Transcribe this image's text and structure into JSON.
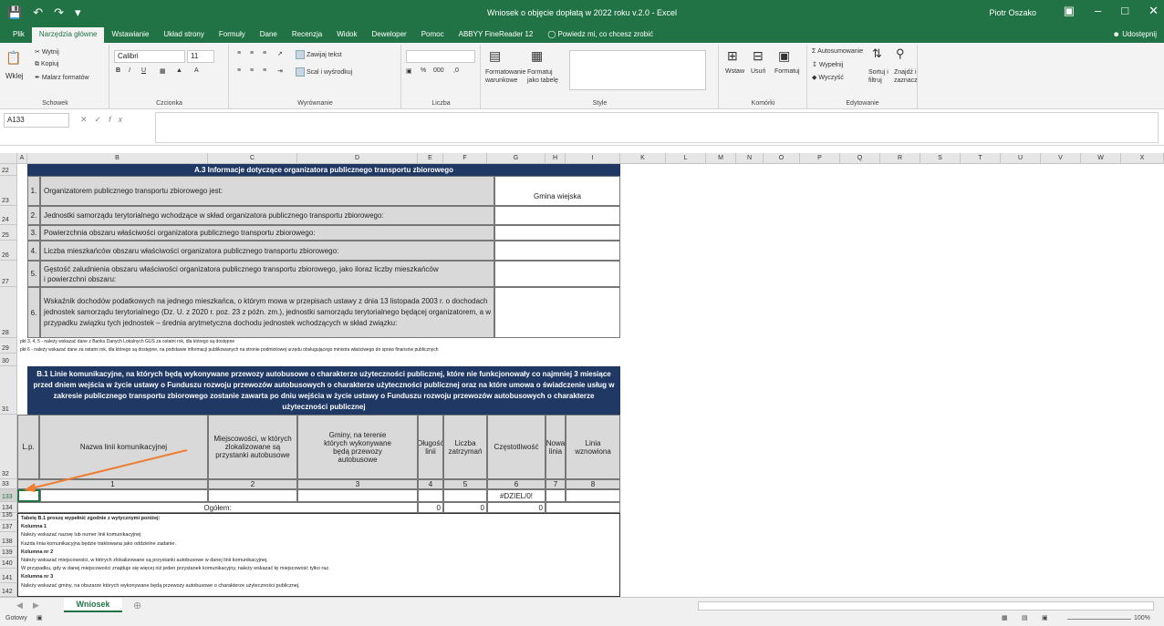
{
  "window": {
    "title": "Wniosek o objęcie dopłatą w 2022 roku v.2.0  -  Excel",
    "user": "Piotr Oszako"
  },
  "tabs": [
    "Plik",
    "Narzędzia główne",
    "Wstawianie",
    "Układ strony",
    "Formuły",
    "Dane",
    "Recenzja",
    "Widok",
    "Deweloper",
    "Pomoc",
    "ABBYY FineReader 12",
    "Powiedz mi, co chcesz zrobić"
  ],
  "share": "Udostępnij",
  "ribbon": {
    "clipboard": {
      "paste": "Wklej",
      "cut": "Wytnij",
      "copy": "Kopiuj",
      "painter": "Malarz formatów",
      "label": "Schowek"
    },
    "font": {
      "name": "Calibri",
      "size": "11",
      "label": "Czcionka"
    },
    "alignment": {
      "wrap": "Zawijaj tekst",
      "merge": "Scal i wyśrodkuj",
      "label": "Wyrównanie"
    },
    "number": {
      "label": "Liczba"
    },
    "styles": {
      "cond": "Formatowanie warunkowe",
      "table": "Formatuj jako tabelę",
      "label": "Style"
    },
    "cells": {
      "insert": "Wstaw",
      "delete": "Usuń",
      "format": "Formatuj",
      "label": "Komórki"
    },
    "editing": {
      "autosum": "Autosumowanie",
      "fill": "Wypełnij",
      "clear": "Wyczyść",
      "sort": "Sortuj i filtruj",
      "find": "Znajdź i zaznacz",
      "label": "Edytowanie"
    }
  },
  "formula": {
    "namebox": "A133",
    "fx": "fx"
  },
  "columns": [
    "A",
    "B",
    "C",
    "D",
    "E",
    "F",
    "G",
    "H",
    "I",
    "K",
    "L",
    "M",
    "N",
    "O",
    "P",
    "Q",
    "R",
    "S",
    "T",
    "U",
    "V",
    "W",
    "X"
  ],
  "rows": [
    "22",
    "23",
    "24",
    "25",
    "26",
    "27",
    "28",
    "29",
    "30",
    "31",
    "32",
    "33",
    "133",
    "134",
    "135",
    "137",
    "138",
    "139",
    "140",
    "141",
    "142"
  ],
  "sheet": {
    "a3_header": "A.3  Informacje dotyczące organizatora publicznego transportu zbiorowego",
    "items": [
      {
        "num": "1.",
        "text": "Organizatorem publicznego transportu zbiorowego jest:",
        "value": "Gmina wiejska"
      },
      {
        "num": "2.",
        "text": "Jednostki samorządu terytorialnego wchodzące w skład organizatora publicznego transportu zbiorowego:",
        "value": ""
      },
      {
        "num": "3.",
        "text": "Powierzchnia obszaru właściwości organizatora publicznego transportu zbiorowego:",
        "value": ""
      },
      {
        "num": "4.",
        "text": "Liczba mieszkańców obszaru właściwości organizatora publicznego transportu zbiorowego:",
        "value": ""
      },
      {
        "num": "5.",
        "text": "Gęstość zaludnienia obszaru właściwości organizatora publicznego transportu zbiorowego, jako iloraz liczby mieszkańców i powierzchni obszaru:",
        "value": ""
      },
      {
        "num": "6.",
        "text": "Wskaźnik dochodów podatkowych na jednego mieszkańca,  o którym mowa w przepisach ustawy z dnia 13 listopada 2003 r. o dochodach jednostek samorządu terytorialnego (Dz. U. z 2020 r. poz. 23  z późn. zm.), jednostki samorządu terytorialnego będącej organizatorem, a w przypadku związku tych jednostek – średnia arytmetyczna dochodu jednostek wchodzących w skład związku:",
        "value": ""
      }
    ],
    "note1": "pkt 3, 4, 5 - należy wskazać dane z Banku Danych Lokalnych GUS za ostatni rok, dla którego są dostępne",
    "note2": "pkt 6 - należy wskazać dane za ostatni rok, dla którego są dostępne, na podstawie informacji publikowanych  na stronie  podmiotowej urzędu obsługującego ministra właściwego do spraw finansów publicznych",
    "b1_header": "B.1 Linie komunikacyjne, na których będą wykonywane przewozy autobusowe o charakterze użyteczności publicznej, które nie funkcjonowały co najmniej 3 miesiące przed dniem wejścia w życie ustawy o Funduszu rozwoju przewozów autobusowych o charakterze użyteczności publicznej oraz na które umowa o świadczenie usług w zakresie publicznego transportu zbiorowego zostanie zawarta po dniu wejścia w życie ustawy o Funduszu rozwoju przewozów autobusowych o charakterze użyteczności publicznej",
    "table_headers": [
      "L.p.",
      "Nazwa linii komunikacyjnej",
      "Miejscowości, w których zlokalizowane są przystanki autobusowe",
      "Gminy, na terenie których wykonywane będą przewozy autobusowe",
      "Długość linii",
      "Liczba zatrzymań",
      "Częstotliwość",
      "Nowa linia",
      "Linia wznowiona"
    ],
    "table_nums": [
      "1",
      "2",
      "3",
      "4",
      "5",
      "6",
      "7",
      "8"
    ],
    "row133_g": "#DZIEL/0!",
    "total_label": "Ogółem:",
    "total_e": "0",
    "total_f": "0",
    "total_g": "0",
    "instructions": [
      "Tabelę B.1 proszę wypełnić zgodnie z wytycznymi poniżej:",
      "Kolumna 1",
      "Należy wskazać nazwę lub numer linii komunikacyjnej",
      "Każda linia komunikacyjna będzie traktowana jako oddzielne zadanie.",
      "Kolumna nr 2",
      "Należy wskazać miejscowości, w których zlokalizowane są przystanki autobusowe w danej linii komunikacyjnej.",
      "W przypadku, gdy w danej miejscowości znajduje się więcej niż jeden przystanek komunikacyjny, należy wskazać tę miejscowość tylko raz.",
      "Kolumna nr 3",
      "Należy wskazać gminy, na obszarze których wykonywane będą przewozy autobusowe o charakterze użyteczności publicznej."
    ]
  },
  "sheet_tab": "Wniosek",
  "status": {
    "ready": "Gotowy",
    "zoom": "100%"
  },
  "colors": {
    "excel_green": "#217346",
    "navy": "#203864",
    "arrow": "#ed7d31"
  }
}
